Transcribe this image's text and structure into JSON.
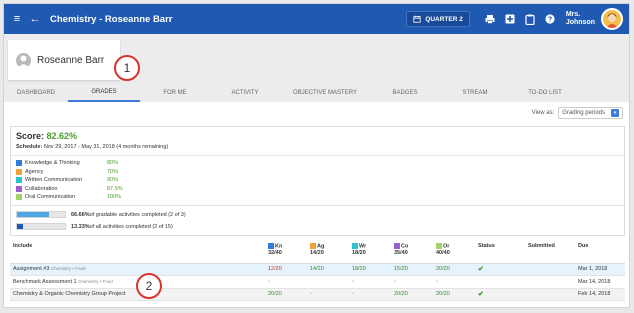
{
  "topbar": {
    "title": "Chemistry - Roseanne Barr",
    "quarter": "QUARTER 2",
    "user_line1": "Mrs.",
    "user_line2": "Johnson"
  },
  "student": {
    "name": "Roseanne Barr"
  },
  "callouts": [
    "1",
    "2"
  ],
  "tabs": [
    {
      "label": "DASHBOARD"
    },
    {
      "label": "GRADES"
    },
    {
      "label": "FOR ME"
    },
    {
      "label": "ACTIVITY"
    },
    {
      "label": "OBJECTIVE MASTERY"
    },
    {
      "label": "BADGES"
    },
    {
      "label": "STREAM"
    },
    {
      "label": "TO-DO LIST"
    }
  ],
  "view_as": {
    "label": "View as:",
    "value": "Grading periods"
  },
  "score": {
    "label": "Score:",
    "value": "82.62%",
    "schedule_label": "Schedule:",
    "schedule_value": "Nov 29, 2017 - May 31, 2018 (4 months remaining)"
  },
  "skills": [
    {
      "name": "Knowledge & Thinking",
      "pct": "80%",
      "color": "#2f7fd6"
    },
    {
      "name": "Agency",
      "pct": "70%",
      "color": "#f2a03a"
    },
    {
      "name": "Written Communication",
      "pct": "90%",
      "color": "#2ec2c9"
    },
    {
      "name": "Collaboration",
      "pct": "87.5%",
      "color": "#9a5fcf"
    },
    {
      "name": "Oral Communication",
      "pct": "100%",
      "color": "#9fd46a"
    }
  ],
  "progress": [
    {
      "bold": "66.66%",
      "text": " of gradable activities completed (2 of 3)",
      "fraction": 0.6666,
      "color": "#4fa8e6"
    },
    {
      "bold": "13.33%",
      "text": " of all activities completed (2 of 15)",
      "fraction": 0.1333,
      "color": "#2059b2"
    }
  ],
  "table": {
    "headers": {
      "include": "Include",
      "kn": "Kn",
      "kn_sub": "32/40",
      "ag": "Ag",
      "ag_sub": "14/20",
      "wr": "Wr",
      "wr_sub": "18/20",
      "co": "Co",
      "co_sub": "35/40",
      "or": "Or",
      "or_sub": "40/40",
      "status": "Status",
      "submitted": "Submitted",
      "due": "Due"
    },
    "rows": [
      {
        "name": "Assignment #3",
        "meta": "Chemistry • Food",
        "kn": "12/20",
        "ag": "14/20",
        "wr": "18/20",
        "co": "15/20",
        "or": "20/20",
        "status": "✔",
        "submitted": "",
        "due": "Mar 1, 2018"
      },
      {
        "name": "Benchmark Assessment 1",
        "meta": "Chemistry • Food",
        "kn": "•",
        "ag": "",
        "wr": "•",
        "co": "•",
        "or": "•",
        "status": "",
        "submitted": "",
        "due": "Mar 14, 2018"
      },
      {
        "name": "Chemistry & Organic Chemistry Group Project",
        "meta": "",
        "kn": "20/20",
        "ag": "•",
        "wr": "•",
        "co": "20/20",
        "or": "20/20",
        "status": "✔",
        "submitted": "",
        "due": "Feb 14, 2018"
      }
    ]
  },
  "colors": {
    "brand": "#2059b2",
    "score_green": "#4a9b2c",
    "callout_red": "#d8332c"
  }
}
